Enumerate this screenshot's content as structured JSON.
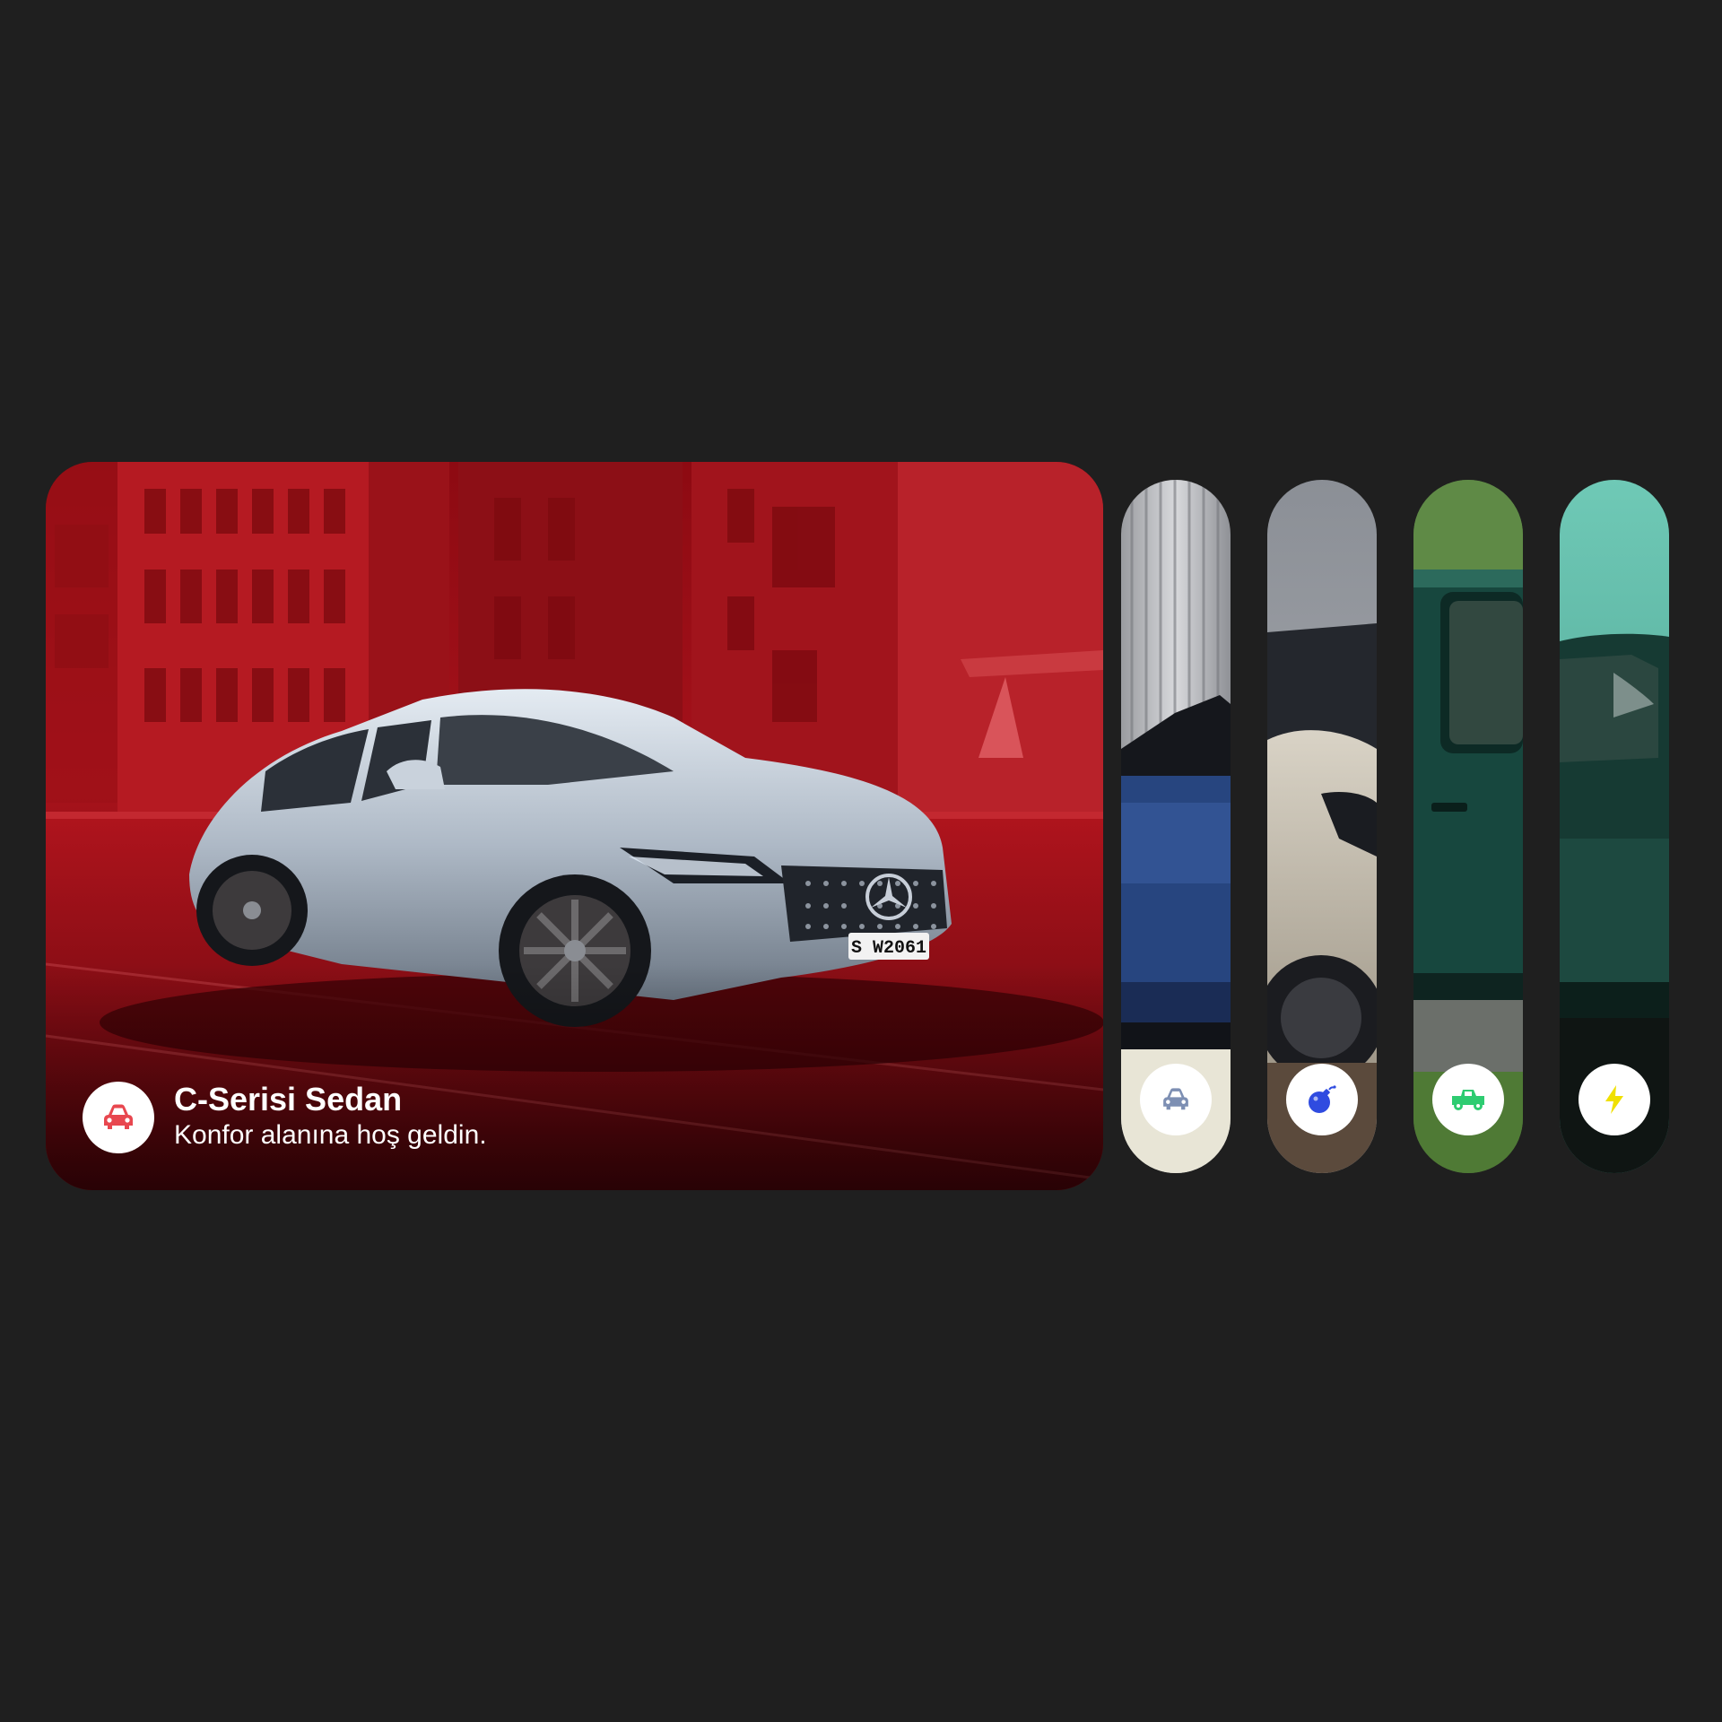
{
  "gallery": {
    "active": {
      "title": "C-Serisi Sedan",
      "subtitle": "Konfor alanına hoş geldin.",
      "icon": "car-icon",
      "icon_color": "#e8474f",
      "plate": "S W2061"
    },
    "items": [
      {
        "icon": "car-icon",
        "icon_color": "#7d8fb3"
      },
      {
        "icon": "bomb-icon",
        "icon_color": "#2f4be0"
      },
      {
        "icon": "truck-icon",
        "icon_color": "#2ecc71"
      },
      {
        "icon": "bolt-icon",
        "icon_color": "#f0e000"
      }
    ]
  },
  "colors": {
    "background": "#1f1f1f",
    "accent_red": "#c0141e"
  }
}
